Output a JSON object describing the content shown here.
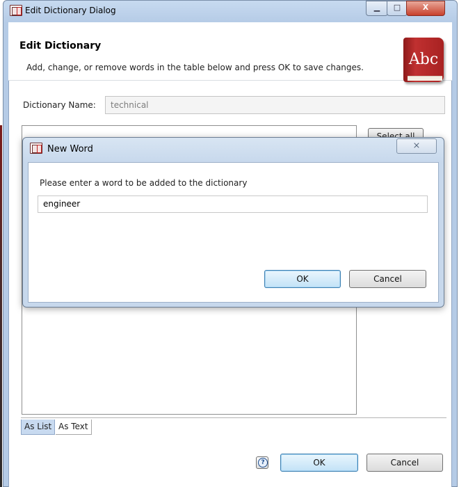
{
  "window": {
    "title": "Edit Dictionary Dialog",
    "minimize_glyph": "▁",
    "maximize_glyph": "□",
    "close_glyph": "X"
  },
  "header": {
    "title": "Edit Dictionary",
    "message": "Add, change, or remove words in the table below and press OK to save changes.",
    "logo_text": "Abc"
  },
  "dictionary": {
    "name_label": "Dictionary Name:",
    "name_value": "technical"
  },
  "side_buttons": {
    "select_all": "Select all"
  },
  "tabs": [
    {
      "label": "As List",
      "selected": true
    },
    {
      "label": "As Text",
      "selected": false
    }
  ],
  "footer": {
    "help_glyph": "?",
    "ok_label": "OK",
    "cancel_label": "Cancel"
  },
  "new_word_dialog": {
    "title": "New Word",
    "close_glyph": "⨯",
    "message": "Please enter a word to be added to the dictionary",
    "word_value": "engineer",
    "ok_label": "OK",
    "cancel_label": "Cancel"
  },
  "icons": {
    "app": "dictionary-book-icon",
    "logo": "abc-book-icon",
    "help": "help-icon"
  },
  "colors": {
    "titlebar": "#b5cbe6",
    "close_button": "#c8412c",
    "logo_red": "#a82222",
    "default_button_border": "#3c7fb1",
    "selected_tab": "#c8daf0"
  }
}
